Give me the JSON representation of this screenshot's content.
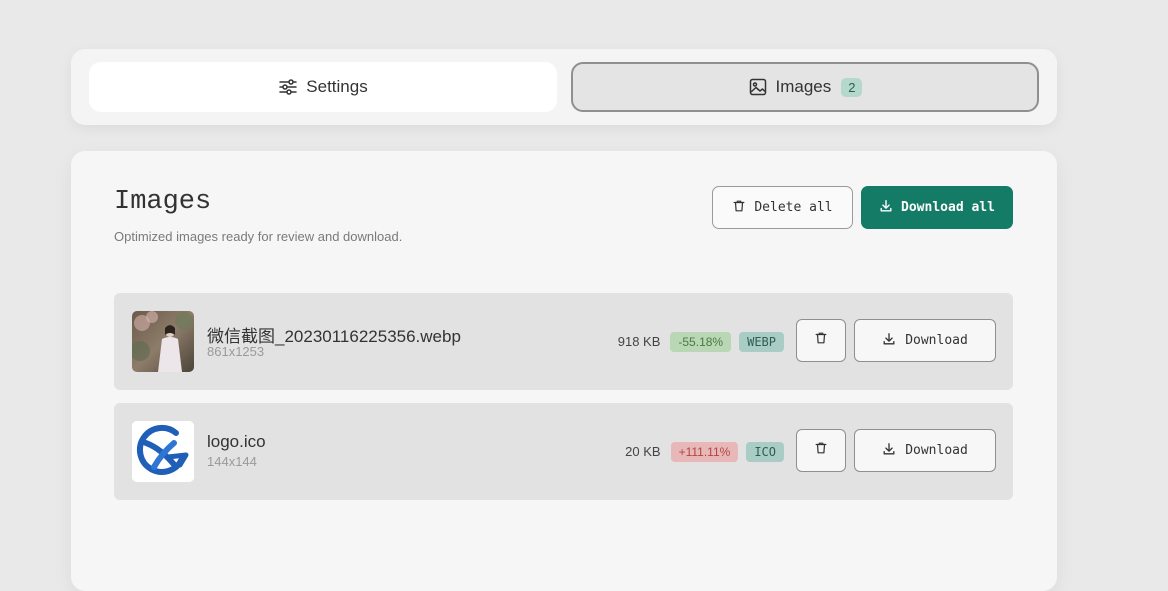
{
  "tabs": {
    "settings": {
      "label": "Settings",
      "icon": "sliders-icon"
    },
    "images": {
      "label": "Images",
      "icon": "image-icon",
      "count": "2"
    }
  },
  "section": {
    "title": "Images",
    "subtitle": "Optimized images ready for review and download.",
    "delete_all_label": "Delete all",
    "download_all_label": "Download all"
  },
  "images": [
    {
      "name": "微信截图_20230116225356.webp",
      "dimensions": "861x1253",
      "size": "918 KB",
      "change": "-55.18%",
      "format": "WEBP",
      "download_label": "Download"
    },
    {
      "name": "logo.ico",
      "dimensions": "144x144",
      "size": "20 KB",
      "change": "+111.11%",
      "format": "ICO",
      "download_label": "Download"
    }
  ],
  "colors": {
    "accent": "#137b66",
    "badge_good_bg": "#b9d7b5",
    "badge_bad_bg": "#e8b7b7",
    "format_badge_bg": "#a9cdc4"
  }
}
